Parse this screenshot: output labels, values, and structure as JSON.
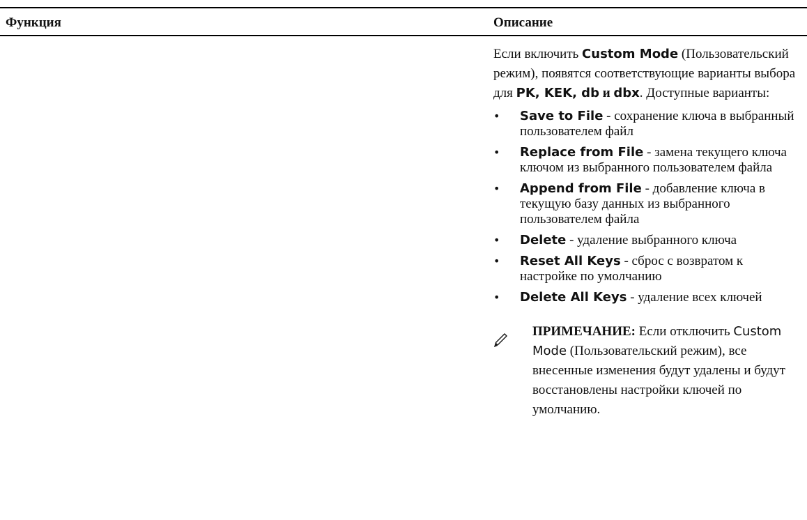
{
  "table": {
    "headers": {
      "function": "Функция",
      "description": "Описание"
    }
  },
  "description": {
    "intro": {
      "part1": "Если включить ",
      "custom_mode": "Custom Mode",
      "part2": " (Пользовательский режим), появятся соответствующие варианты выбора для ",
      "keys": "PK, KEK, db",
      "and_word": " и ",
      "dbx": "dbx",
      "part3": ". Доступные варианты:"
    },
    "options": [
      {
        "name": "Save to File",
        "text": " - сохранение ключа в выбранный пользователем файл"
      },
      {
        "name": "Replace from File",
        "text": " - замена текущего ключа ключом из выбранного пользователем файла"
      },
      {
        "name": "Append from File",
        "text": " - добавление ключа в текущую базу данных из выбранного пользователем файла"
      },
      {
        "name": "Delete",
        "text": " - удаление выбранного ключа"
      },
      {
        "name": "Reset All Keys",
        "text": " - сброс с возвратом к настройке по умолчанию"
      },
      {
        "name": "Delete All Keys",
        "text": " - удаление всех ключей"
      }
    ],
    "bullet_glyph": "•",
    "note": {
      "icon": "pencil-icon",
      "label": "ПРИМЕЧАНИЕ:",
      "part1": " Если отключить ",
      "custom_mode": "Custom Mode",
      "part2": " (Пользовательский режим), все внесенные изменения будут удалены и будут восстановлены настройки ключей по умолчанию."
    }
  }
}
